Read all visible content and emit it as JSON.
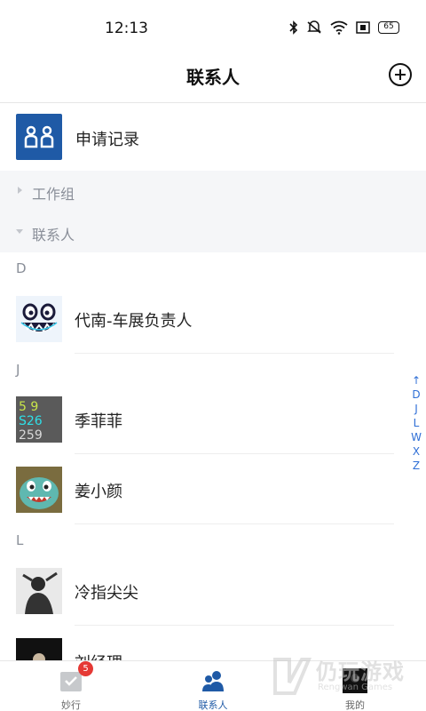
{
  "status_bar": {
    "time": "12:13",
    "battery": "65"
  },
  "header": {
    "title": "联系人"
  },
  "apply_record": {
    "label": "申请记录"
  },
  "groups": [
    {
      "label": "工作组",
      "state": "collapsed"
    },
    {
      "label": "联系人",
      "state": "expanded"
    }
  ],
  "sections": [
    {
      "letter": "D",
      "contacts": [
        {
          "name": "代南-车展负责人"
        }
      ]
    },
    {
      "letter": "J",
      "contacts": [
        {
          "name": "季菲菲"
        },
        {
          "name": "姜小颜"
        }
      ]
    },
    {
      "letter": "L",
      "contacts": [
        {
          "name": "冷指尖尖"
        },
        {
          "name": "刘经理"
        }
      ]
    }
  ],
  "index_bar": [
    "↑",
    "D",
    "J",
    "L",
    "W",
    "X",
    "Z"
  ],
  "tabs": [
    {
      "label": "妙行",
      "badge": "5",
      "active": false
    },
    {
      "label": "联系人",
      "active": true
    },
    {
      "label": "我的",
      "active": false
    }
  ],
  "watermark": {
    "text": "仍玩游戏",
    "sub": "Rengwan Games"
  },
  "colors": {
    "accent": "#1f5aa6",
    "index": "#2f6fd6",
    "badge": "#e53935"
  }
}
